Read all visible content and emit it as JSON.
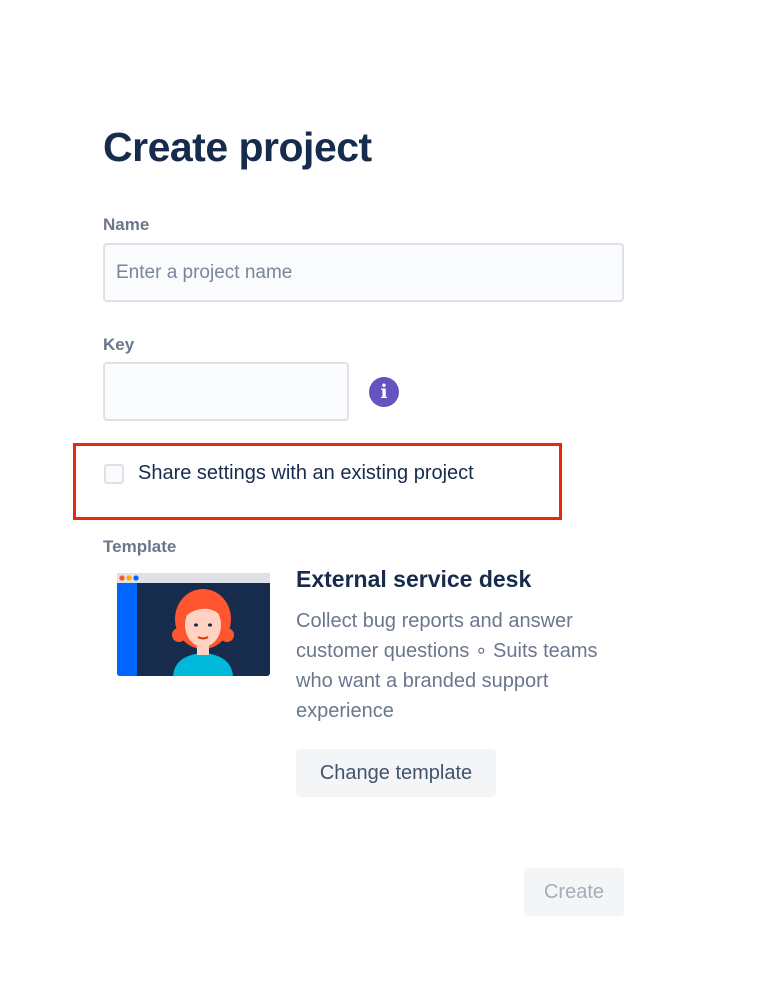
{
  "page": {
    "title": "Create project"
  },
  "form": {
    "name_label": "Name",
    "name_placeholder": "Enter a project name",
    "name_value": "",
    "key_label": "Key",
    "key_value": "",
    "key_info_icon": "info-icon",
    "share_checkbox_label": "Share settings with an existing project",
    "share_checked": false
  },
  "template": {
    "section_label": "Template",
    "name": "External service desk",
    "description": "Collect bug reports and answer customer questions ∘ Suits teams who want a branded support experience",
    "change_button_label": "Change template"
  },
  "actions": {
    "create_label": "Create",
    "create_disabled": true
  },
  "colors": {
    "heading": "#172b4d",
    "label": "#6b778c",
    "info_icon": "#6554c0",
    "highlight_border": "#e8270c",
    "thumbnail_sidebar": "#0065ff",
    "thumbnail_background": "#172b4d"
  }
}
